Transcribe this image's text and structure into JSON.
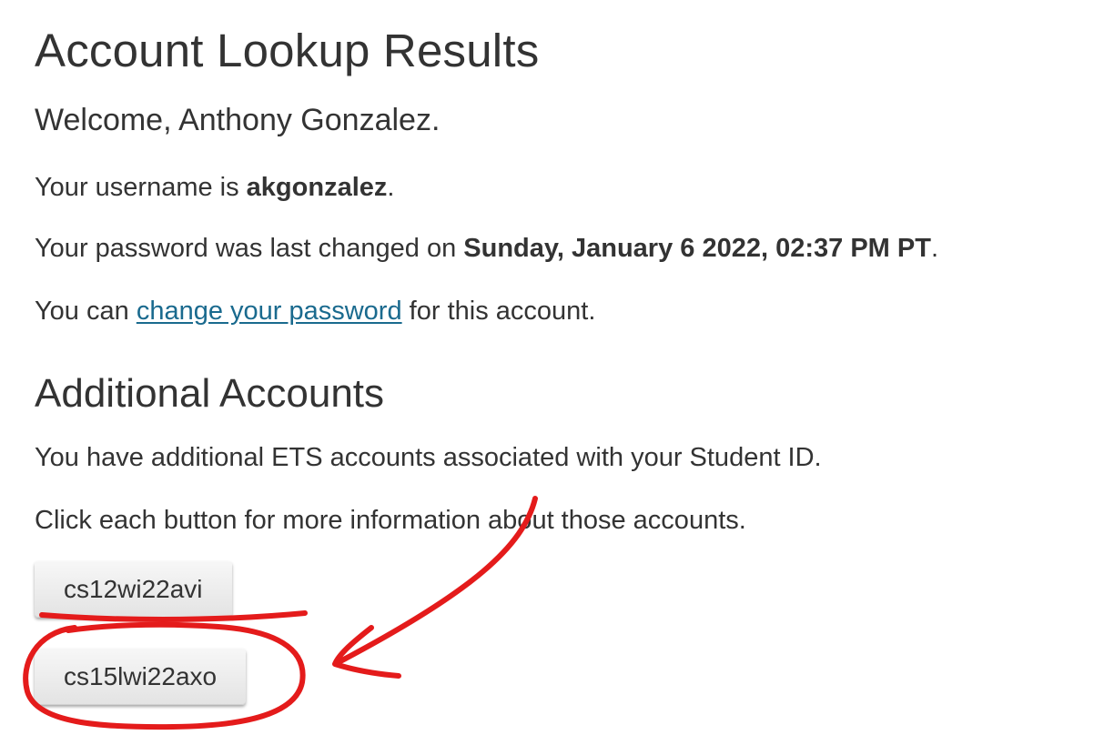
{
  "heading": "Account Lookup Results",
  "welcome": "Welcome, Anthony Gonzalez.",
  "username_line": {
    "prefix": "Your username is ",
    "username": "akgonzalez",
    "suffix": "."
  },
  "password_line": {
    "prefix": "Your password was last changed on ",
    "date": "Sunday, January 6 2022, 02:37 PM PT",
    "suffix": "."
  },
  "change_line": {
    "prefix": "You can ",
    "link": "change your password",
    "suffix": " for this account."
  },
  "additional": {
    "heading": "Additional Accounts",
    "intro": "You have additional ETS accounts associated with your Student ID.",
    "instruction": "Click each button for more information about those accounts.",
    "accounts": [
      "cs12wi22avi",
      "cs15lwi22axo"
    ]
  },
  "annotation_color": "#e41b1b"
}
